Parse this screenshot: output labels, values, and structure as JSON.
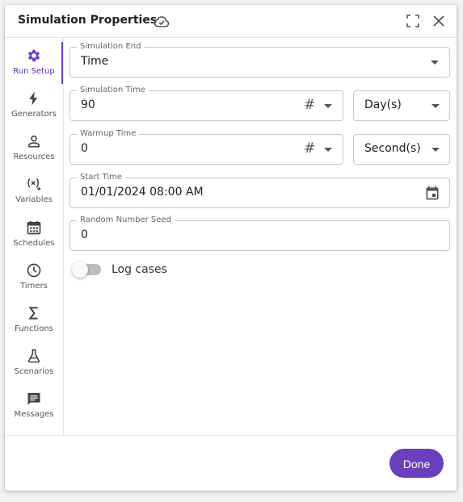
{
  "dialog": {
    "title": "Simulation Properties",
    "icons": {
      "sync": "cloud-check-icon",
      "expand": "expand-icon",
      "close": "close-icon"
    }
  },
  "sidebar": {
    "items": [
      {
        "label": "Run Setup",
        "icon": "gear-icon",
        "active": true
      },
      {
        "label": "Generators",
        "icon": "lightning-icon"
      },
      {
        "label": "Resources",
        "icon": "person-icon"
      },
      {
        "label": "Variables",
        "icon": "variable-icon"
      },
      {
        "label": "Schedules",
        "icon": "calendar-icon"
      },
      {
        "label": "Timers",
        "icon": "clock-icon"
      },
      {
        "label": "Functions",
        "icon": "sigma-icon"
      },
      {
        "label": "Scenarios",
        "icon": "flask-icon"
      },
      {
        "label": "Messages",
        "icon": "message-icon"
      }
    ]
  },
  "form": {
    "simulation_end": {
      "label": "Simulation End",
      "value": "Time"
    },
    "simulation_time": {
      "label": "Simulation Time",
      "value": "90",
      "unit": "Day(s)",
      "hash": "#"
    },
    "warmup_time": {
      "label": "Warmup Time",
      "value": "0",
      "unit": "Second(s)",
      "hash": "#"
    },
    "start_time": {
      "label": "Start Time",
      "value": "01/01/2024 08:00 AM"
    },
    "random_seed": {
      "label": "Random Number Seed",
      "value": "0"
    },
    "log_cases": {
      "label": "Log cases",
      "checked": false
    }
  },
  "footer": {
    "done_label": "Done"
  },
  "colors": {
    "accent": "#6a3fbd",
    "active_text": "#5a2fa8"
  }
}
